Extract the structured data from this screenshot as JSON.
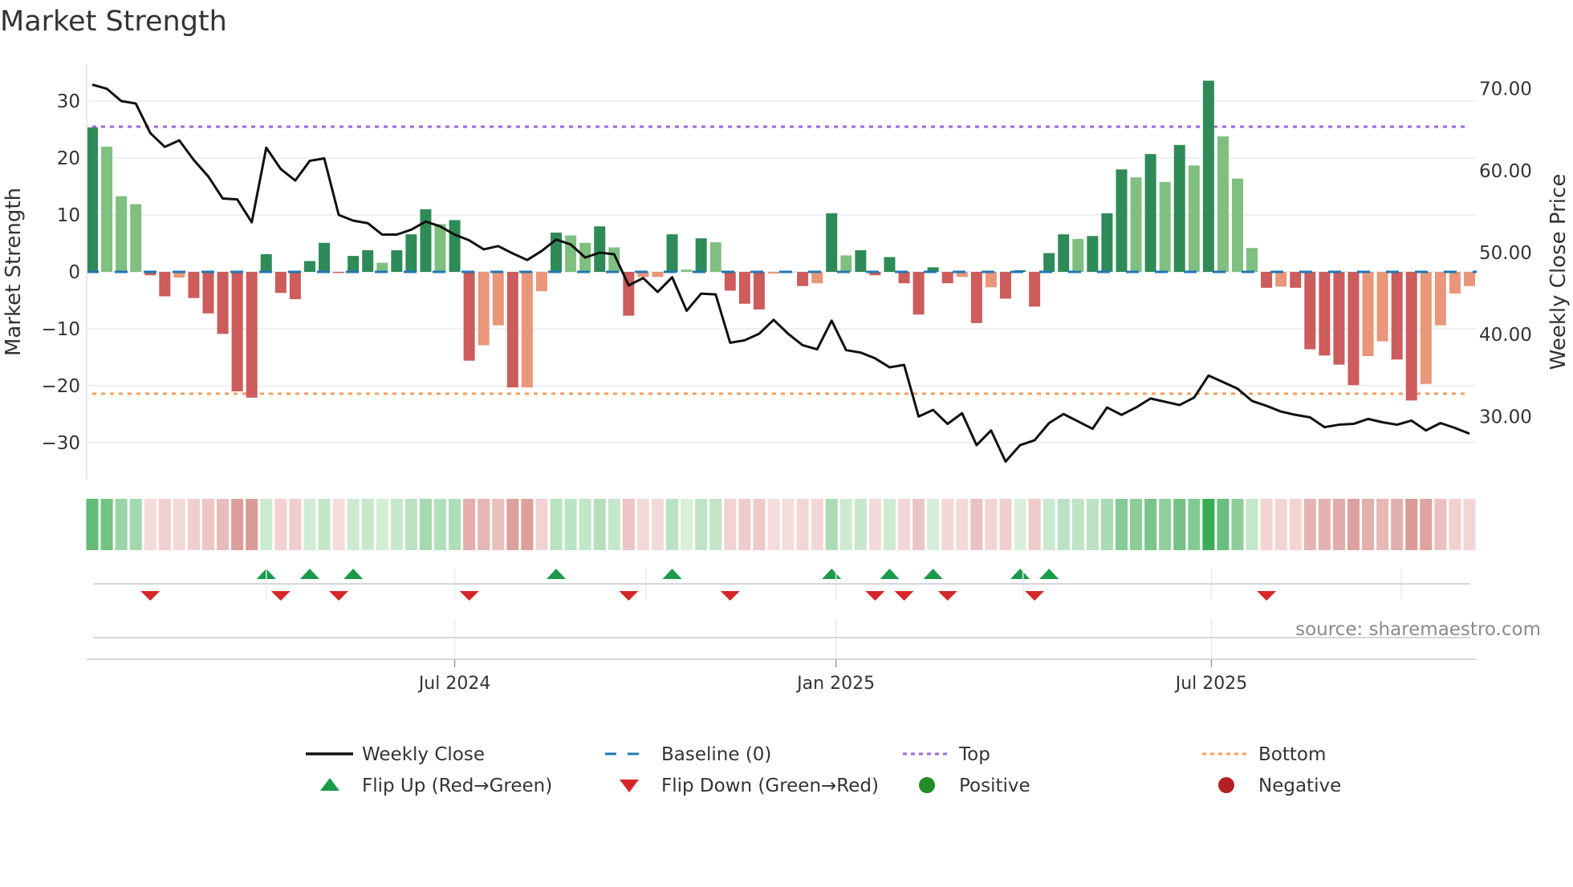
{
  "chart_data": {
    "type": "bar",
    "title": "Market Strength",
    "ylabel": "Market Strength",
    "y2label": "Weekly Close Price",
    "ylim": [
      -36.5,
      36.5
    ],
    "y2lim": [
      22.3,
      73.0
    ],
    "yticks": [
      30,
      20,
      10,
      0,
      -10,
      -20,
      -30
    ],
    "yticklabels": [
      "30",
      "20",
      "10",
      "0",
      "−10",
      "−20",
      "−30"
    ],
    "y2ticks": [
      70,
      60,
      50,
      40,
      30
    ],
    "y2ticklabels": [
      "70.00",
      "60.00",
      "50.00",
      "40.00",
      "30.00"
    ],
    "xticks": [
      {
        "pos": 25.0,
        "label": "Jul 2024"
      },
      {
        "pos": 51.3,
        "label": "Jan 2025"
      },
      {
        "pos": 77.2,
        "label": "Jul 2025"
      }
    ],
    "minor_xgrid": [
      12.0,
      38.2,
      64.2,
      90.3
    ],
    "top_level": 25.5,
    "bottom_level": -21.4,
    "baseline": 0,
    "series": [
      {
        "name": "Market Strength",
        "type": "bar",
        "values": [
          25.4,
          22.0,
          13.3,
          11.9,
          -0.6,
          -4.3,
          -1.0,
          -4.6,
          -7.3,
          -10.9,
          -21.0,
          -22.1,
          3.1,
          -3.7,
          -4.8,
          1.9,
          5.1,
          -0.2,
          2.8,
          3.8,
          1.6,
          3.8,
          6.6,
          11.0,
          8.4,
          9.1,
          -15.6,
          -12.9,
          -9.4,
          -20.3,
          -20.3,
          -3.4,
          6.9,
          6.4,
          5.1,
          8.0,
          4.3,
          -7.7,
          -0.9,
          -0.9,
          6.6,
          0.4,
          5.9,
          5.2,
          -3.3,
          -5.6,
          -6.6,
          -0.3,
          -0.1,
          -2.5,
          -2.0,
          10.3,
          2.9,
          3.8,
          -0.6,
          2.6,
          -2.0,
          -7.5,
          0.8,
          -2.0,
          -0.9,
          -9.0,
          -2.7,
          -4.7,
          0.3,
          -6.1,
          3.3,
          6.6,
          5.8,
          6.3,
          10.3,
          18.0,
          16.6,
          20.7,
          15.8,
          22.3,
          18.7,
          33.6,
          23.8,
          16.4,
          4.2,
          -2.8,
          -2.6,
          -2.8,
          -13.6,
          -14.7,
          -16.3,
          -19.9,
          -14.8,
          -12.2,
          -15.4,
          -22.6,
          -19.7,
          -9.4,
          -3.8,
          -2.5
        ]
      },
      {
        "name": "Weekly Close",
        "type": "line",
        "axis": "right",
        "values": [
          70.5,
          70.0,
          68.5,
          68.2,
          64.6,
          62.9,
          63.7,
          61.3,
          59.3,
          56.6,
          56.5,
          53.7,
          62.8,
          60.2,
          58.8,
          61.2,
          61.5,
          54.6,
          53.9,
          53.6,
          52.2,
          52.2,
          52.8,
          53.8,
          53.2,
          52.2,
          51.5,
          50.4,
          50.8,
          49.9,
          49.1,
          50.2,
          51.6,
          51.0,
          49.4,
          50.0,
          49.8,
          46.0,
          46.9,
          45.2,
          47.0,
          42.9,
          45.0,
          44.9,
          39.0,
          39.3,
          40.1,
          41.8,
          40.1,
          38.7,
          38.2,
          41.7,
          38.1,
          37.8,
          37.1,
          36.0,
          36.3,
          30.0,
          30.8,
          29.1,
          30.4,
          26.5,
          28.3,
          24.5,
          26.5,
          27.1,
          29.2,
          30.3,
          29.4,
          28.5,
          31.1,
          30.2,
          31.1,
          32.2,
          31.8,
          31.4,
          32.3,
          35.0,
          34.2,
          33.4,
          31.9,
          31.3,
          30.6,
          30.2,
          29.9,
          28.7,
          29.0,
          29.1,
          29.7,
          29.3,
          29.0,
          29.5,
          28.3,
          29.2,
          28.6,
          27.9
        ]
      }
    ],
    "flip_up_indices": [
      12,
      15,
      18,
      32,
      40,
      51,
      55,
      58,
      64,
      66
    ],
    "flip_down_indices": [
      4,
      13,
      17,
      26,
      37,
      44,
      54,
      56,
      59,
      65,
      81
    ],
    "legend": {
      "placement": "bottom",
      "items": [
        {
          "label": "Weekly Close",
          "kind": "line"
        },
        {
          "label": "Baseline (0)",
          "kind": "dash"
        },
        {
          "label": "Top",
          "kind": "dot-purple"
        },
        {
          "label": "Bottom",
          "kind": "dot-orange"
        },
        {
          "label": "Flip Up (Red→Green)",
          "kind": "tri-up"
        },
        {
          "label": "Flip Down (Green→Red)",
          "kind": "tri-down"
        },
        {
          "label": "Positive",
          "kind": "circle-green"
        },
        {
          "label": "Negative",
          "kind": "circle-red"
        }
      ]
    },
    "annotation": "source: sharemaestro.com",
    "colors": {
      "pos_strong": "#2e8b57",
      "pos_weak": "#7fbf7f",
      "neg_strong": "#cd5c5c",
      "neg_weak": "#e9967a",
      "line": "#111111",
      "baseline": "#1f77b4",
      "top": "#a066dd",
      "bottom": "#f0a060",
      "flip_up": "#1a9a4a",
      "flip_down": "#d62728",
      "positive": "#228b22",
      "negative": "#b22222"
    }
  }
}
